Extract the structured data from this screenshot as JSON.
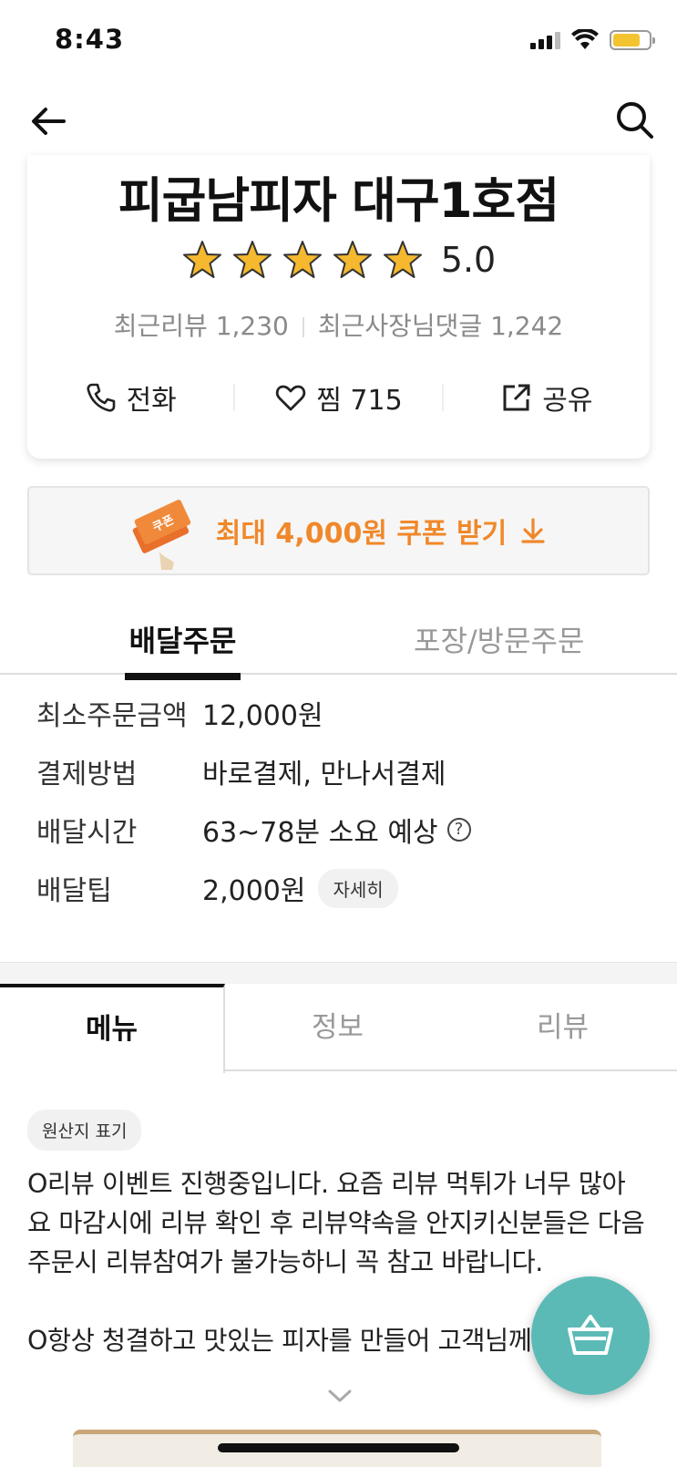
{
  "status_bar": {
    "time": "8:43",
    "battery_level": 0.75,
    "icons": [
      "signal-icon",
      "wifi-icon",
      "battery-icon"
    ]
  },
  "nav": {
    "back_icon": "arrow-left-icon",
    "search_icon": "search-icon"
  },
  "store": {
    "name": "피굽남피자 대구1호점",
    "rating": "5.0",
    "stars": 5,
    "recent_reviews": "최근리뷰 1,230",
    "recent_owner_replies": "최근사장님댓글 1,242",
    "actions": {
      "call": "전화",
      "favorite": "찜 715",
      "share": "공유"
    }
  },
  "coupon": {
    "label": "최대 4,000원 쿠폰 받기",
    "badge_text": "쿠폰"
  },
  "order_tabs": {
    "delivery": "배달주문",
    "pickup": "포장/방문주문"
  },
  "info": {
    "min_order_label": "최소주문금액",
    "min_order_value": "12,000원",
    "payment_label": "결제방법",
    "payment_value": "바로결제, 만나서결제",
    "time_label": "배달시간",
    "time_value": "63~78분 소요 예상",
    "tip_label": "배달팁",
    "tip_value": "2,000원",
    "tip_detail": "자세히"
  },
  "menu_tabs": {
    "menu": "메뉴",
    "info": "정보",
    "review": "리뷰"
  },
  "origin_chip": "원산지 표기",
  "notice": {
    "p1": "O리뷰 이벤트 진행중입니다. 요즘 리뷰 먹튀가 너무 많아요 마감시에 리뷰 확인 후 리뷰약속을 안지키신분들은 다음 주문시 리뷰참여가 불가능하니 꼭 참고 바랍니다.",
    "p2": "O항상 청결하고 맛있는 피자를 만들어 고객님께"
  },
  "colors": {
    "accent_orange": "#f0882a",
    "fab_teal": "#5bbab6",
    "star_gold": "#f5b82e"
  }
}
